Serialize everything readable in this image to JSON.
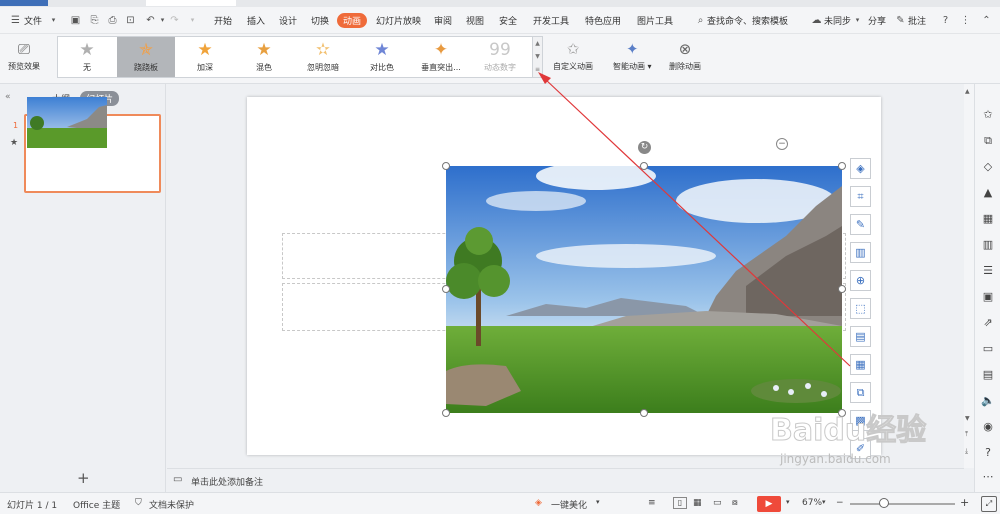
{
  "colors": {
    "accent": "#ef6b3a",
    "arrow": "#e0383a",
    "selected_gallery": "#b3b6ba"
  },
  "menubar": {
    "file_label": "文件",
    "tabs": [
      {
        "label": "开始",
        "active": false
      },
      {
        "label": "插入",
        "active": false
      },
      {
        "label": "设计",
        "active": false
      },
      {
        "label": "切换",
        "active": false
      },
      {
        "label": "动画",
        "active": true
      },
      {
        "label": "幻灯片放映",
        "active": false
      },
      {
        "label": "审阅",
        "active": false
      },
      {
        "label": "视图",
        "active": false
      },
      {
        "label": "安全",
        "active": false
      },
      {
        "label": "开发工具",
        "active": false
      },
      {
        "label": "特色应用",
        "active": false
      },
      {
        "label": "图片工具",
        "active": false
      }
    ],
    "search_label": "查找命令、搜索模板",
    "sync_label": "未同步",
    "share_label": "分享",
    "comment_label": "批注"
  },
  "ribbon": {
    "preview_label": "预览效果",
    "gallery": [
      {
        "label": "无",
        "icon": "star-gray-icon",
        "selected": false,
        "disabled": false
      },
      {
        "label": "跷跷板",
        "icon": "star-seesaw-icon",
        "selected": true,
        "disabled": false
      },
      {
        "label": "加深",
        "icon": "star-darken-icon",
        "selected": false,
        "disabled": false
      },
      {
        "label": "混色",
        "icon": "star-blend-icon",
        "selected": false,
        "disabled": false
      },
      {
        "label": "忽明忽暗",
        "icon": "star-flicker-icon",
        "selected": false,
        "disabled": false
      },
      {
        "label": "对比色",
        "icon": "star-contrast-icon",
        "selected": false,
        "disabled": false
      },
      {
        "label": "垂直突出...",
        "icon": "star-vertical-icon",
        "selected": false,
        "disabled": false
      },
      {
        "label": "动态数字",
        "icon": "dynamic-number-icon",
        "selected": false,
        "disabled": true
      }
    ],
    "custom_animation_label": "自定义动画",
    "smart_animation_label": "智能动画",
    "delete_animation_label": "删除动画"
  },
  "panel": {
    "outline_tab": "大纲",
    "slides_tab": "幻灯片",
    "slide_number": "1"
  },
  "notes": {
    "placeholder": "单击此处添加备注"
  },
  "statusbar": {
    "slide_info": "幻灯片 1 / 1",
    "theme": "Office 主题",
    "protection": "文档未保护",
    "beautify": "一键美化",
    "zoom": "67%"
  },
  "watermark": {
    "brand": "Baidu经验",
    "url": "jingyan.baidu.com"
  }
}
